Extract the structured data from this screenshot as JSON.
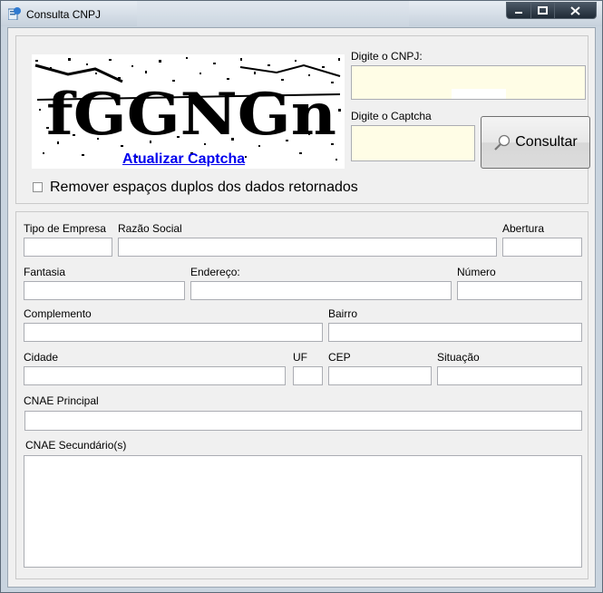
{
  "window": {
    "title": "Consulta CNPJ",
    "colors": {
      "frame": "#c9d4df",
      "client": "#f0f0f0",
      "input_highlight": "#fffde6",
      "link": "#0000ee",
      "close_button": "#2a3440"
    }
  },
  "captcha": {
    "image_text": "fGGNGn",
    "refresh_link": "Atualizar Captcha"
  },
  "form_top": {
    "cnpj_label": "Digite o CNPJ:",
    "cnpj_value": "",
    "captcha_label": "Digite o Captcha",
    "captcha_value": "",
    "consult_button": "Consultar",
    "consult_icon": "magnifier-icon",
    "remove_spaces_label": "Remover espaços duplos dos dados retornados",
    "remove_spaces_checked": false
  },
  "results": {
    "tipo_empresa": "Tipo de Empresa",
    "razao_social": "Razão Social",
    "abertura": "Abertura",
    "fantasia": "Fantasia",
    "endereco": "Endereço:",
    "numero": "Número",
    "complemento": "Complemento",
    "bairro": "Bairro",
    "cidade": "Cidade",
    "uf": "UF",
    "cep": "CEP",
    "situacao": "Situação",
    "cnae_principal": "CNAE Principal",
    "cnae_secundario": "CNAE Secundário(s)"
  }
}
